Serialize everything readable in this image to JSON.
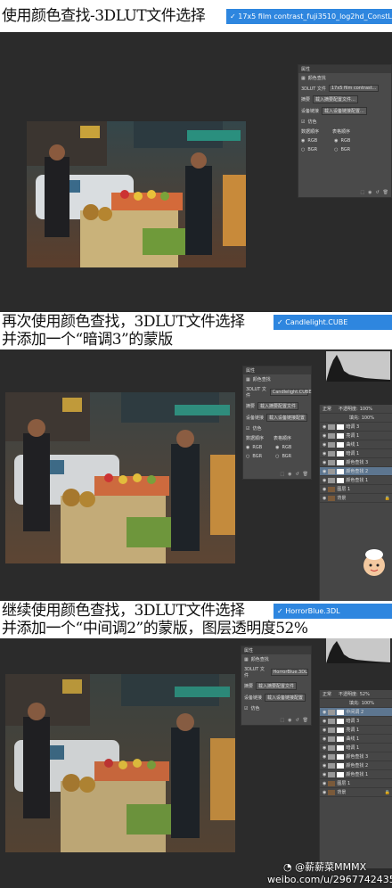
{
  "steps": [
    {
      "caption_lines": [
        "使用颜色查找-3DLUT文件选择"
      ],
      "lut_file": "17x5 film contrast_fuji3510_log2hd_ConstLmap.cube",
      "panel": {
        "tabs": [
          "属性",
          "颜色查找"
        ],
        "rows": [
          {
            "label": "3DLUT 文件",
            "value": "17x5 film contrast..."
          },
          {
            "label": "摘要",
            "value": "载入摘要配置文件..."
          },
          {
            "label": "设备链接",
            "value": "载入设备链接配置..."
          }
        ],
        "dither": "仿色",
        "data_order": "数据顺序",
        "table_order": "表格顺序",
        "rgb": "RGB",
        "bgr": "BGR"
      }
    },
    {
      "caption_lines": [
        "再次使用颜色查找，3DLUT文件选择",
        "并添加一个“暗调3”的蒙版"
      ],
      "lut_file": "Candlelight.CUBE",
      "panel": {
        "tabs": [
          "属性",
          "颜色查找"
        ],
        "rows": [
          {
            "label": "3DLUT 文件",
            "value": "Candlelight.CUBE"
          },
          {
            "label": "摘要",
            "value": "载入摘要配置文件"
          },
          {
            "label": "设备链接",
            "value": "载入设备链接配置"
          }
        ],
        "dither": "仿色",
        "data_order": "数据顺序",
        "table_order": "表格顺序",
        "rgb": "RGB",
        "bgr": "BGR"
      },
      "layers": {
        "blend": "正常",
        "opacity_label": "不透明度:",
        "opacity": "100%",
        "fill_label": "填充:",
        "fill": "100%",
        "items": [
          "暗调 3",
          "亮调 1",
          "曲线 1",
          "暗调 1",
          "颜色查找 3",
          "颜色查找 2",
          "颜色查找 1",
          "图层 1",
          "背景"
        ]
      }
    },
    {
      "caption_lines": [
        "继续使用颜色查找，3DLUT文件选择",
        "并添加一个“中间调2”的蒙版，图层透明度52%"
      ],
      "lut_file": "HorrorBlue.3DL",
      "panel": {
        "tabs": [
          "属性",
          "颜色查找"
        ],
        "rows": [
          {
            "label": "3DLUT 文件",
            "value": "HorrorBlue.3DL"
          },
          {
            "label": "摘要",
            "value": "载入摘要配置文件"
          },
          {
            "label": "设备链接",
            "value": "载入设备链接配置"
          }
        ],
        "dither": "仿色"
      },
      "layers": {
        "blend": "正常",
        "opacity_label": "不透明度:",
        "opacity": "52%",
        "fill_label": "填充:",
        "fill": "100%",
        "items": [
          "中间调 2",
          "暗调 3",
          "亮调 1",
          "曲线 1",
          "暗调 1",
          "颜色查找 3",
          "颜色查找 2",
          "颜色查找 1",
          "图层 1",
          "背景"
        ]
      }
    }
  ],
  "watermark": {
    "handle": "@薪薪菜MMMX",
    "url": "weibo.com/u/2967742435"
  }
}
